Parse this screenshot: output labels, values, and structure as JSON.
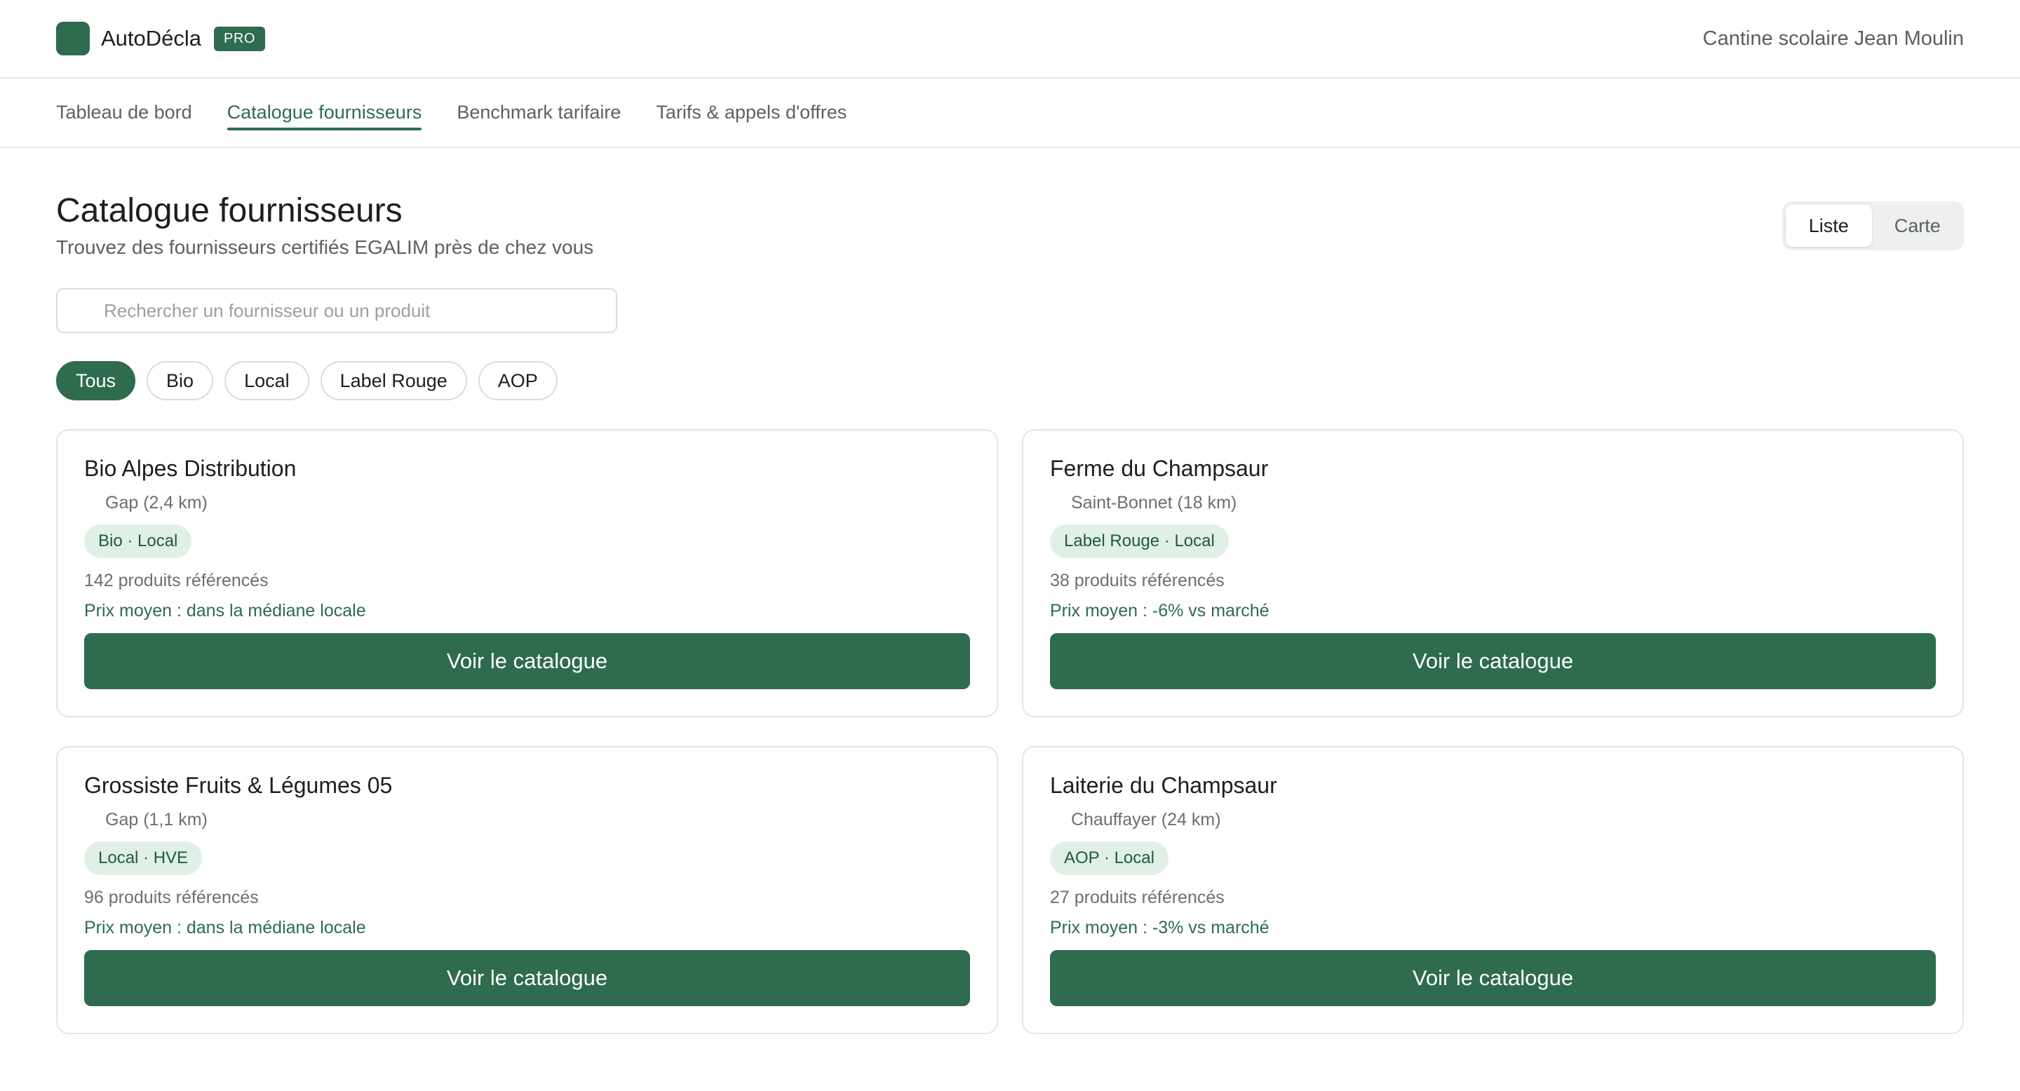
{
  "app": {
    "name": "AutoDécla",
    "badge": "PRO",
    "organization": "Cantine scolaire Jean Moulin"
  },
  "nav": {
    "tabs": [
      {
        "label": "Tableau de bord"
      },
      {
        "label": "Catalogue fournisseurs",
        "active": true
      },
      {
        "label": "Benchmark tarifaire"
      },
      {
        "label": "Tarifs & appels d'offres"
      }
    ]
  },
  "page": {
    "title": "Catalogue fournisseurs",
    "subtitle": "Trouvez des fournisseurs certifiés EGALIM près de chez vous"
  },
  "view_toggle": {
    "options": [
      "Liste",
      "Carte"
    ],
    "selected": "Liste"
  },
  "search": {
    "placeholder": "Rechercher un fournisseur ou un produit",
    "value": ""
  },
  "filters": {
    "options": [
      "Tous",
      "Bio",
      "Local",
      "Label Rouge",
      "AOP"
    ],
    "selected": "Tous"
  },
  "suppliers": [
    {
      "name": "Bio Alpes Distribution",
      "location": "Gap (2,4 km)",
      "tags": "Bio · Local",
      "count": "142 produits référencés",
      "price": "Prix moyen : dans la médiane locale",
      "cta": "Voir le catalogue"
    },
    {
      "name": "Ferme du Champsaur",
      "location": "Saint-Bonnet (18 km)",
      "tags": "Label Rouge · Local",
      "count": "38 produits référencés",
      "price": "Prix moyen : -6% vs marché",
      "cta": "Voir le catalogue"
    },
    {
      "name": "Grossiste Fruits & Légumes 05",
      "location": "Gap (1,1 km)",
      "tags": "Local · HVE",
      "count": "96 produits référencés",
      "price": "Prix moyen : dans la médiane locale",
      "cta": "Voir le catalogue"
    },
    {
      "name": "Laiterie du Champsaur",
      "location": "Chauffayer (24 km)",
      "tags": "AOP · Local",
      "count": "27 produits référencés",
      "price": "Prix moyen : -3% vs marché",
      "cta": "Voir le catalogue"
    }
  ],
  "colors": {
    "accent": "#2e6b4f",
    "tag_bg": "#e0f0e6",
    "border": "#e3e6e4"
  }
}
